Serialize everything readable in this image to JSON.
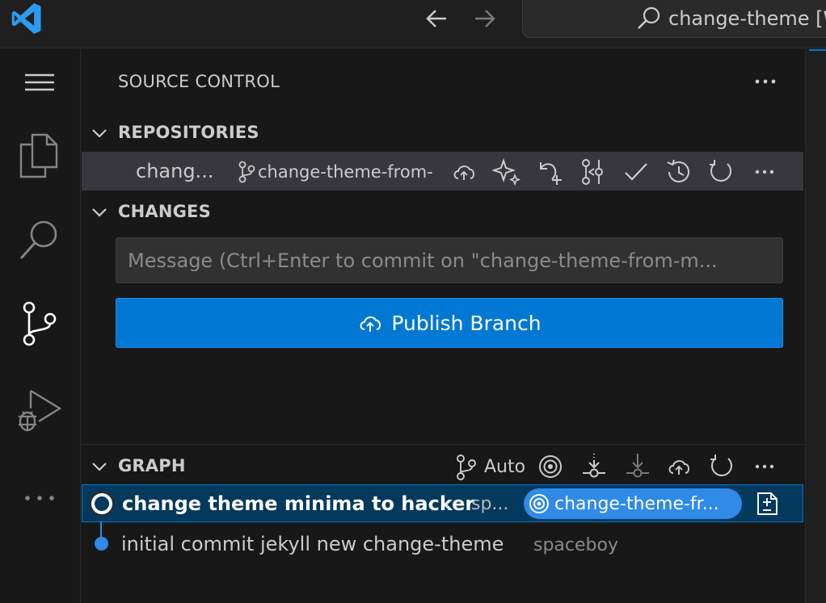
{
  "titlebar": {
    "command_center_text": "change-theme [W"
  },
  "activity_bar": {
    "items": [
      "menu-icon",
      "explorer-icon",
      "search-icon",
      "source-control-icon",
      "run-debug-icon",
      "more-icon"
    ]
  },
  "sidebar": {
    "title": "SOURCE CONTROL",
    "repositories": {
      "label": "REPOSITORIES",
      "repo_name": "chang...",
      "branch": "change-theme-from-"
    },
    "changes": {
      "label": "CHANGES",
      "message_placeholder": "Message (Ctrl+Enter to commit on \"change-theme-from-m...",
      "message_value": "",
      "publish_label": "Publish Branch"
    },
    "graph": {
      "label": "GRAPH",
      "auto_label": "Auto",
      "commits": [
        {
          "message": "change theme minima to hacker",
          "author": "sp...",
          "branch_badge": "change-theme-fr..."
        },
        {
          "message": "initial commit jekyll new change-theme",
          "author": "spaceboy"
        }
      ]
    }
  },
  "colors": {
    "accent": "#0078d4",
    "badge": "#2f8ae8",
    "selected_row": "#04395e",
    "background": "#181818"
  }
}
